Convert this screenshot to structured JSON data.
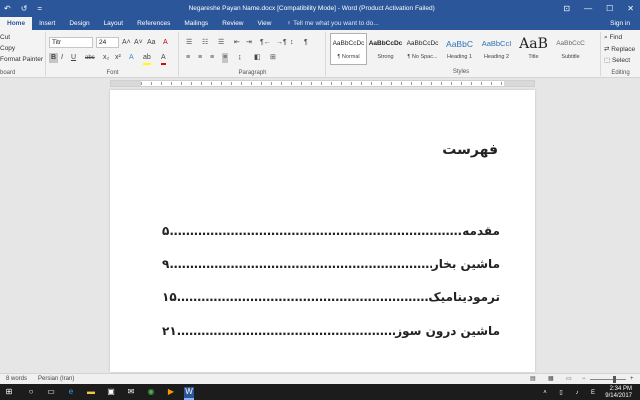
{
  "window": {
    "title": "Negareshe Payan Name.docx [Compatibility Mode] - Word (Product Activation Failed)",
    "qat": {
      "undo": "↶",
      "redo": "↺",
      "customize": "="
    },
    "controls": {
      "options": "⊡",
      "minimize": "—",
      "maximize": "☐",
      "close": "✕"
    }
  },
  "tabs": [
    "Home",
    "Insert",
    "Design",
    "Layout",
    "References",
    "Mailings",
    "Review",
    "View"
  ],
  "tell_me": "Tell me what you want to do...",
  "sign_in": "Sign in",
  "clipboard": {
    "cut": "Cut",
    "copy": "Copy",
    "format_painter": "Format Painter",
    "label": "board"
  },
  "font": {
    "name": "Titr",
    "size": "24",
    "label": "Font",
    "grow": "A˄",
    "shrink": "A˅",
    "case": "Aa",
    "clear": "A",
    "bold": "B",
    "italic": "I",
    "underline": "U",
    "strike": "abc",
    "subscript": "x₂",
    "superscript": "x²",
    "effects": "A",
    "highlight": "ab",
    "color": "A"
  },
  "paragraph": {
    "label": "Paragraph",
    "pilcrow": "¶",
    "ltr": "¶←",
    "rtl": "→¶"
  },
  "styles": {
    "label": "Styles",
    "items": [
      {
        "preview": "AaBbCcDc",
        "name": "¶ Normal"
      },
      {
        "preview": "AaBbCcDc",
        "name": "Strong"
      },
      {
        "preview": "AaBbCcDc",
        "name": "¶ No Spac..."
      },
      {
        "preview": "AaBbC",
        "name": "Heading 1"
      },
      {
        "preview": "AaBbCcI",
        "name": "Heading 2"
      },
      {
        "preview": "AaB",
        "name": "Title"
      },
      {
        "preview": "AaBbCcC",
        "name": "Subtitle"
      }
    ]
  },
  "editing": {
    "find": "Find",
    "replace": "Replace",
    "select": "Select",
    "label": "Editing"
  },
  "document": {
    "heading": "فهرست",
    "entries": [
      {
        "text": "مقدمه",
        "page": "۵"
      },
      {
        "text": "ماشین بخار",
        "page": "۹"
      },
      {
        "text": "ترمودینامیک",
        "page": "۱۵"
      },
      {
        "text": "ماشین درون سوز",
        "page": "۲۱"
      }
    ]
  },
  "status": {
    "words": "8 words",
    "language": "Persian (Iran)"
  },
  "taskbar": {
    "time": "2:34 PM",
    "date": "9/14/2017",
    "icons": [
      "start-icon",
      "search-icon",
      "task-view-icon",
      "edge-icon",
      "file-explorer-icon",
      "store-icon",
      "mail-icon",
      "chrome-icon",
      "media-icon",
      "word-icon"
    ]
  },
  "colors": {
    "word_blue": "#2b579a",
    "ribbon": "#f3f3f3",
    "taskbar": "#1c1c1c"
  }
}
